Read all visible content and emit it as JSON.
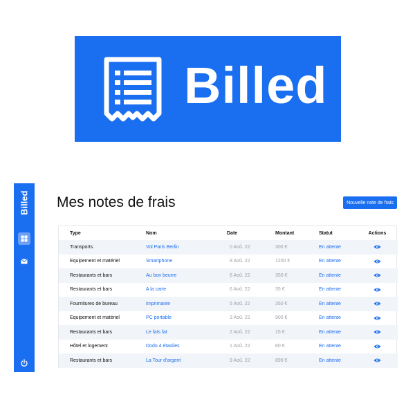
{
  "logo": {
    "text": "Billed"
  },
  "sidebar": {
    "title": "Billed",
    "items": [
      {
        "name": "bills",
        "icon": "window-icon",
        "active": true
      },
      {
        "name": "mail",
        "icon": "mail-icon",
        "active": false
      }
    ],
    "logout_icon": "power-icon"
  },
  "header": {
    "title": "Mes notes de frais",
    "new_bill_label": "Nouvelle note de frais"
  },
  "table": {
    "columns": [
      "Type",
      "Nom",
      "Date",
      "Montant",
      "Statut",
      "Actions"
    ],
    "rows": [
      {
        "type": "Transports",
        "nom": "Vol Paris Berlin",
        "date": "0 Aoû. 22",
        "amount": "300 €",
        "status": "En attente"
      },
      {
        "type": "Equipement et matériel",
        "nom": "Smartphone",
        "date": "8 Aoû. 22",
        "amount": "1200 €",
        "status": "En attente"
      },
      {
        "type": "Restaurants et bars",
        "nom": "Au bon beurre",
        "date": "6 Aoû. 22",
        "amount": "350 €",
        "status": "En attente"
      },
      {
        "type": "Restaurants et bars",
        "nom": "A la carte",
        "date": "6 Aoû. 22",
        "amount": "35 €",
        "status": "En attente"
      },
      {
        "type": "Fournitures de bureau",
        "nom": "Imprimante",
        "date": "5 Aoû. 22",
        "amount": "350 €",
        "status": "En attente"
      },
      {
        "type": "Equipement et matériel",
        "nom": "PC portable",
        "date": "3 Aoû. 22",
        "amount": "900 €",
        "status": "En attente"
      },
      {
        "type": "Restaurants et bars",
        "nom": "Le fats fat",
        "date": "2 Aoû. 22",
        "amount": "15 €",
        "status": "En attente"
      },
      {
        "type": "Hôtel et logement",
        "nom": "Dodo 4 étaoiles",
        "date": "1 Aoû. 22",
        "amount": "60 €",
        "status": "En attente"
      },
      {
        "type": "Restaurants et bars",
        "nom": "La Tour d'argent",
        "date": "9 Aoû. 22",
        "amount": "899 €",
        "status": "En attente"
      }
    ]
  },
  "colors": {
    "brand": "#1a6ef0",
    "row_alt": "#f1f4f8",
    "muted": "#9aa0a6"
  }
}
